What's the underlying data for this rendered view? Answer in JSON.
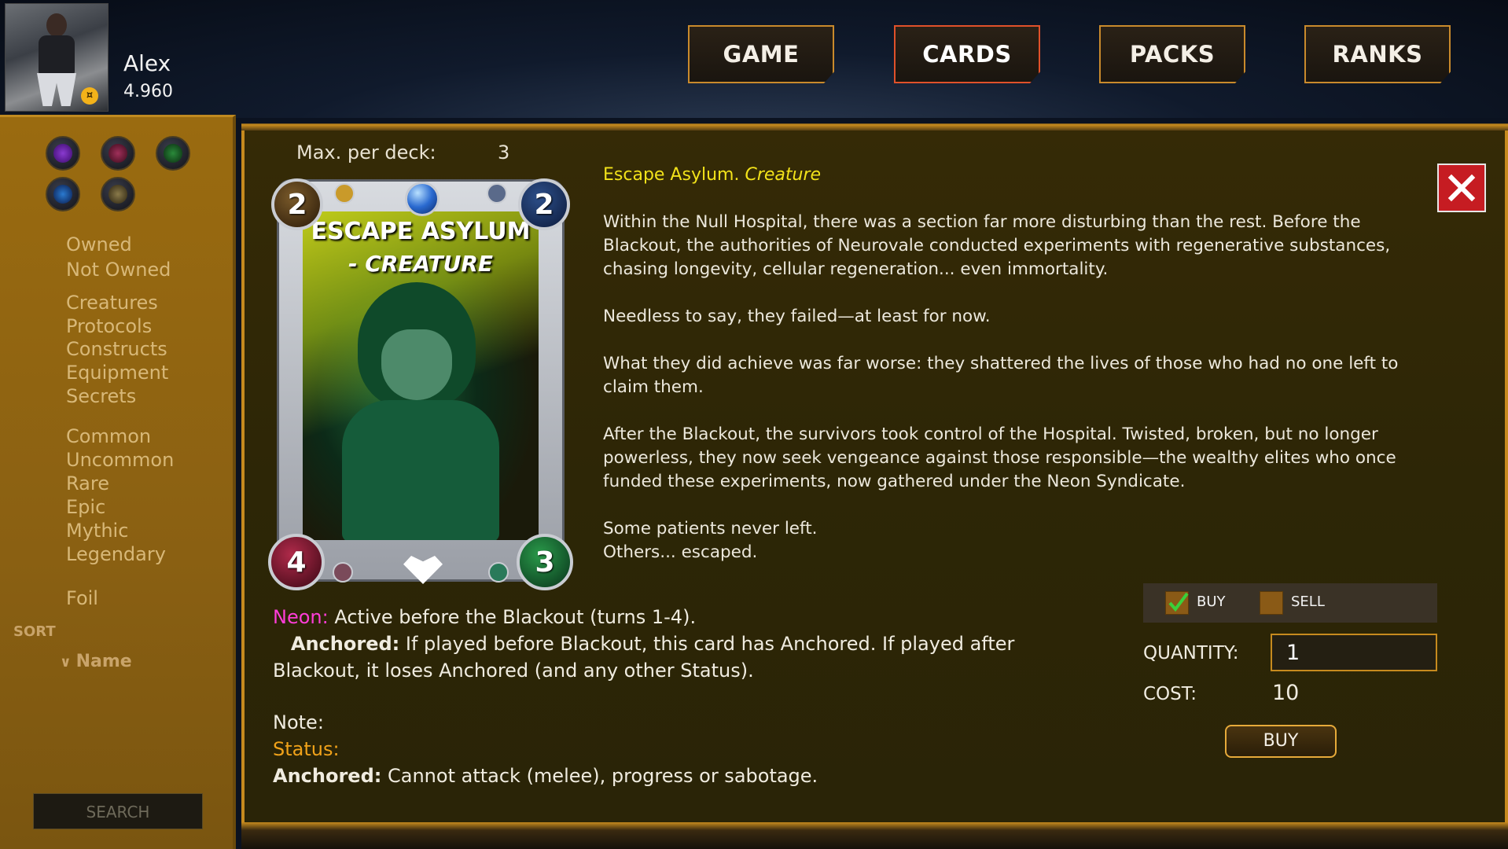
{
  "player": {
    "name": "Alex",
    "rating": "4.960"
  },
  "nav": {
    "game": "GAME",
    "cards": "CARDS",
    "packs": "PACKS",
    "ranks": "RANKS"
  },
  "sidebar": {
    "ownership": [
      "Owned",
      "Not Owned"
    ],
    "types": [
      "Creatures",
      "Protocols",
      "Constructs",
      "Equipment",
      "Secrets"
    ],
    "rarities": [
      "Common",
      "Uncommon",
      "Rare",
      "Epic",
      "Mythic",
      "Legendary"
    ],
    "foil": "Foil",
    "sort_title": "SORT",
    "sort_name": "Name",
    "search": "SEARCH",
    "faction_icons": [
      "skull-faction-icon",
      "flame-faction-icon",
      "cross-faction-icon",
      "brain-faction-icon",
      "hexagon-faction-icon"
    ]
  },
  "deck": {
    "label": "Max. per deck:",
    "value": "3"
  },
  "card": {
    "title": "ESCAPE ASYLUM",
    "type": "- CREATURE",
    "cost": "2",
    "power": "2",
    "attack": "4",
    "health": "3"
  },
  "lore": {
    "title_name": "Escape Asylum.",
    "title_type": "Creature",
    "p1": "Within the Null Hospital, there was a section far more disturbing than the rest. Before the Blackout, the authorities of Neurovale conducted experiments with regenerative substances, chasing longevity, cellular regeneration... even immortality.",
    "p2": "Needless to say, they failed—at least for now.",
    "p3": "What they did achieve was far worse: they shattered the lives of those who had no one left to claim them.",
    "p4": "After the Blackout, the survivors took control of the Hospital. Twisted, broken, but no longer powerless, they now seek vengeance against those responsible—the wealthy elites who once funded these experiments, now gathered under the Neon Syndicate.",
    "p5a": "Some patients never left.",
    "p5b": "Others... escaped."
  },
  "abilities": {
    "neon_label": "Neon:",
    "neon_text": "Active before the Blackout (turns 1-4).",
    "anchored_label": "Anchored:",
    "anchored_text": "If played before Blackout, this card has Anchored. If played after Blackout, it loses Anchored (and any other Status)."
  },
  "notes": {
    "note_label": "Note:",
    "status_label": "Status:",
    "anchored_label": "Anchored:",
    "anchored_text": "Cannot attack (melee), progress or sabotage."
  },
  "trade": {
    "buy_label": "BUY",
    "sell_label": "SELL",
    "buy_checked": true,
    "sell_checked": false,
    "quantity_label": "QUANTITY:",
    "quantity_value": "1",
    "cost_label": "COST:",
    "cost_value": "10",
    "buy_button": "BUY"
  },
  "colors": {
    "accent": "#c68a1e",
    "active_nav": "#e0512a",
    "close": "#c61c22",
    "neon": "#ff3dd8",
    "status": "#f0a21a",
    "lore_title": "#f2e21a"
  }
}
